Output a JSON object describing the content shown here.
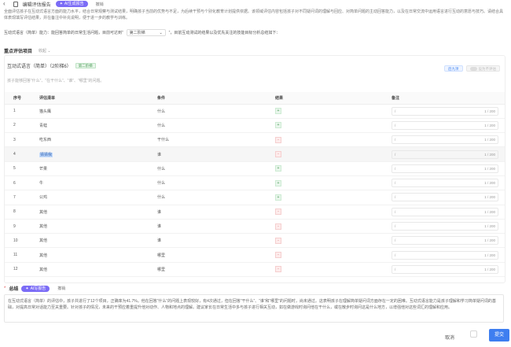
{
  "topbar": {
    "title": "编辑评估报告",
    "ai_button": "AI生成报告",
    "undo": "撤销"
  },
  "intro_text": "全面评估孩子在互动式语言方面的能力水平，结合日常观察与测试结果，明确孩子当前的优势与不足，为后续干预与个别化教育计划提供依据。该领域评估内容包括孩子对不同疑问词的理解与回应、对简单问题的主动回答能力，以及在日常交流中运用语言进行互动的意愿与技巧。请结合具体表现填写评估结果，并在备注中补充说明，便于进一步的教学与训练。",
  "prompt": {
    "text_before": "互动式语言（简单）能力：能回答简单的日常生活问题，目前可达到“",
    "select_value": "第二阶梯",
    "text_after": "”，目前互动测试的结果以及优先关注的技能目标分析总结如下："
  },
  "section": {
    "title": "重点评估项目",
    "collapse": "收起"
  },
  "card": {
    "title": "互动式语言（简单）（2阶梯6）",
    "badge": "第二阶梯",
    "subtitle": "孩子能够回答“什么”、“在干什么”、“谁”、“哪里”的问题。",
    "action_primary": "后九项",
    "action_secondary": "设为不评估"
  },
  "table": {
    "headers": [
      "序号",
      "评估清单",
      "条件",
      "结果",
      "备注"
    ],
    "rows": [
      {
        "no": "1",
        "item": "猫头鹰",
        "cond": "什么",
        "result": "+",
        "note": "/",
        "count": "1 / 200"
      },
      {
        "no": "2",
        "item": "青蛙",
        "cond": "什么",
        "result": "+",
        "note": "/",
        "count": "1 / 200"
      },
      {
        "no": "3",
        "item": "吃东西",
        "cond": "干什么",
        "result": "-",
        "note": "/",
        "count": "1 / 200"
      },
      {
        "no": "4",
        "item": "猜猜我",
        "cond": "谁",
        "result": "-",
        "note": "/",
        "count": "1 / 200"
      },
      {
        "no": "5",
        "item": "芒果",
        "cond": "什么",
        "result": "+",
        "note": "/",
        "count": "1 / 200"
      },
      {
        "no": "6",
        "item": "牛",
        "cond": "什么",
        "result": "+",
        "note": "/",
        "count": "1 / 200"
      },
      {
        "no": "7",
        "item": "公鸡",
        "cond": "什么",
        "result": "+",
        "note": "/",
        "count": "1 / 200"
      },
      {
        "no": "8",
        "item": "其他",
        "cond": "谁",
        "result": "-",
        "note": "/",
        "count": "1 / 200"
      },
      {
        "no": "9",
        "item": "其他",
        "cond": "谁",
        "result": "-",
        "note": "/",
        "count": "1 / 200"
      },
      {
        "no": "10",
        "item": "其他",
        "cond": "谁",
        "result": "-",
        "note": "/",
        "count": "1 / 200"
      },
      {
        "no": "11",
        "item": "其他",
        "cond": "哪里",
        "result": "-",
        "note": "/",
        "count": "1 / 200"
      },
      {
        "no": "12",
        "item": "其他",
        "cond": "哪里",
        "result": "-",
        "note": "/",
        "count": "1 / 200"
      }
    ]
  },
  "summary": {
    "label": "总结",
    "ai_button": "AI写报告",
    "undo": "撤销",
    "text": "在互动式语言（简单）的评估中，孩子共进行了12个项目，正确率为41.7%。他在回答“什么”的问题上表现较好，有4次通过，但在回答“干什么”、“谁”和“哪里”的问题时，尚未通过。这表明孩子在理解简单疑问词方面存在一定的困难。互动式语言能力是孩子理解和学习简单疑问词的基础，对提高日常对话能力至关重要。针对孩子的情况，未来的干预应着重提升他对动作、人物和地点的理解。建议家长在日常生活中多与孩子进行相关互动，如在做游戏时询问他在干什么，或在散步时询问这是什么地方，以增强他对这些词汇的理解和应用。"
  },
  "footer": {
    "cancel": "取消",
    "submit": "提交"
  },
  "colors": {
    "accent": "#3e7ef0",
    "ai_purple": "#7b6cf6",
    "pass_green": "#4a9a56",
    "fail_red": "#d06a6a"
  }
}
